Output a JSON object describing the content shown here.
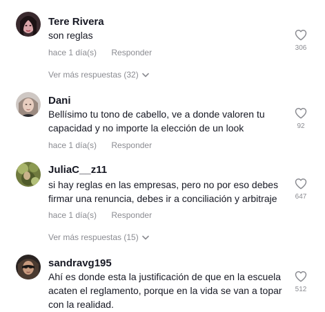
{
  "comments": [
    {
      "username": "Tere Rivera",
      "text": "son reglas",
      "time": "hace 1 día(s)",
      "reply_label": "Responder",
      "likes": "306",
      "avatar_icon": "user-avatar-photo",
      "view_more": "Ver más respuestas (32)"
    },
    {
      "username": "Dani",
      "text": "Bellísimo tu tono de cabello, ve a donde valoren tu capacidad y no importe la elección de un look",
      "time": "hace 1 día(s)",
      "reply_label": "Responder",
      "likes": "92",
      "avatar_icon": "user-avatar-photo"
    },
    {
      "username": "JuliaC__z11",
      "text": "si hay reglas en las empresas, pero no por eso debes firmar una renuncia, debes ir a conciliación y arbitraje",
      "time": "hace 1 día(s)",
      "reply_label": "Responder",
      "likes": "647",
      "avatar_icon": "user-avatar-photo",
      "view_more": "Ver más respuestas (15)"
    },
    {
      "username": "sandravg195",
      "text": "Ahí es donde esta la justificación de que en la escuela acaten el reglamento, porque en la vida se van a topar con la realidad.",
      "likes": "512",
      "avatar_icon": "user-avatar-photo"
    }
  ],
  "colors": {
    "primary_text": "#161823",
    "secondary_text": "#8a8b91",
    "icon": "#8a8b91"
  }
}
